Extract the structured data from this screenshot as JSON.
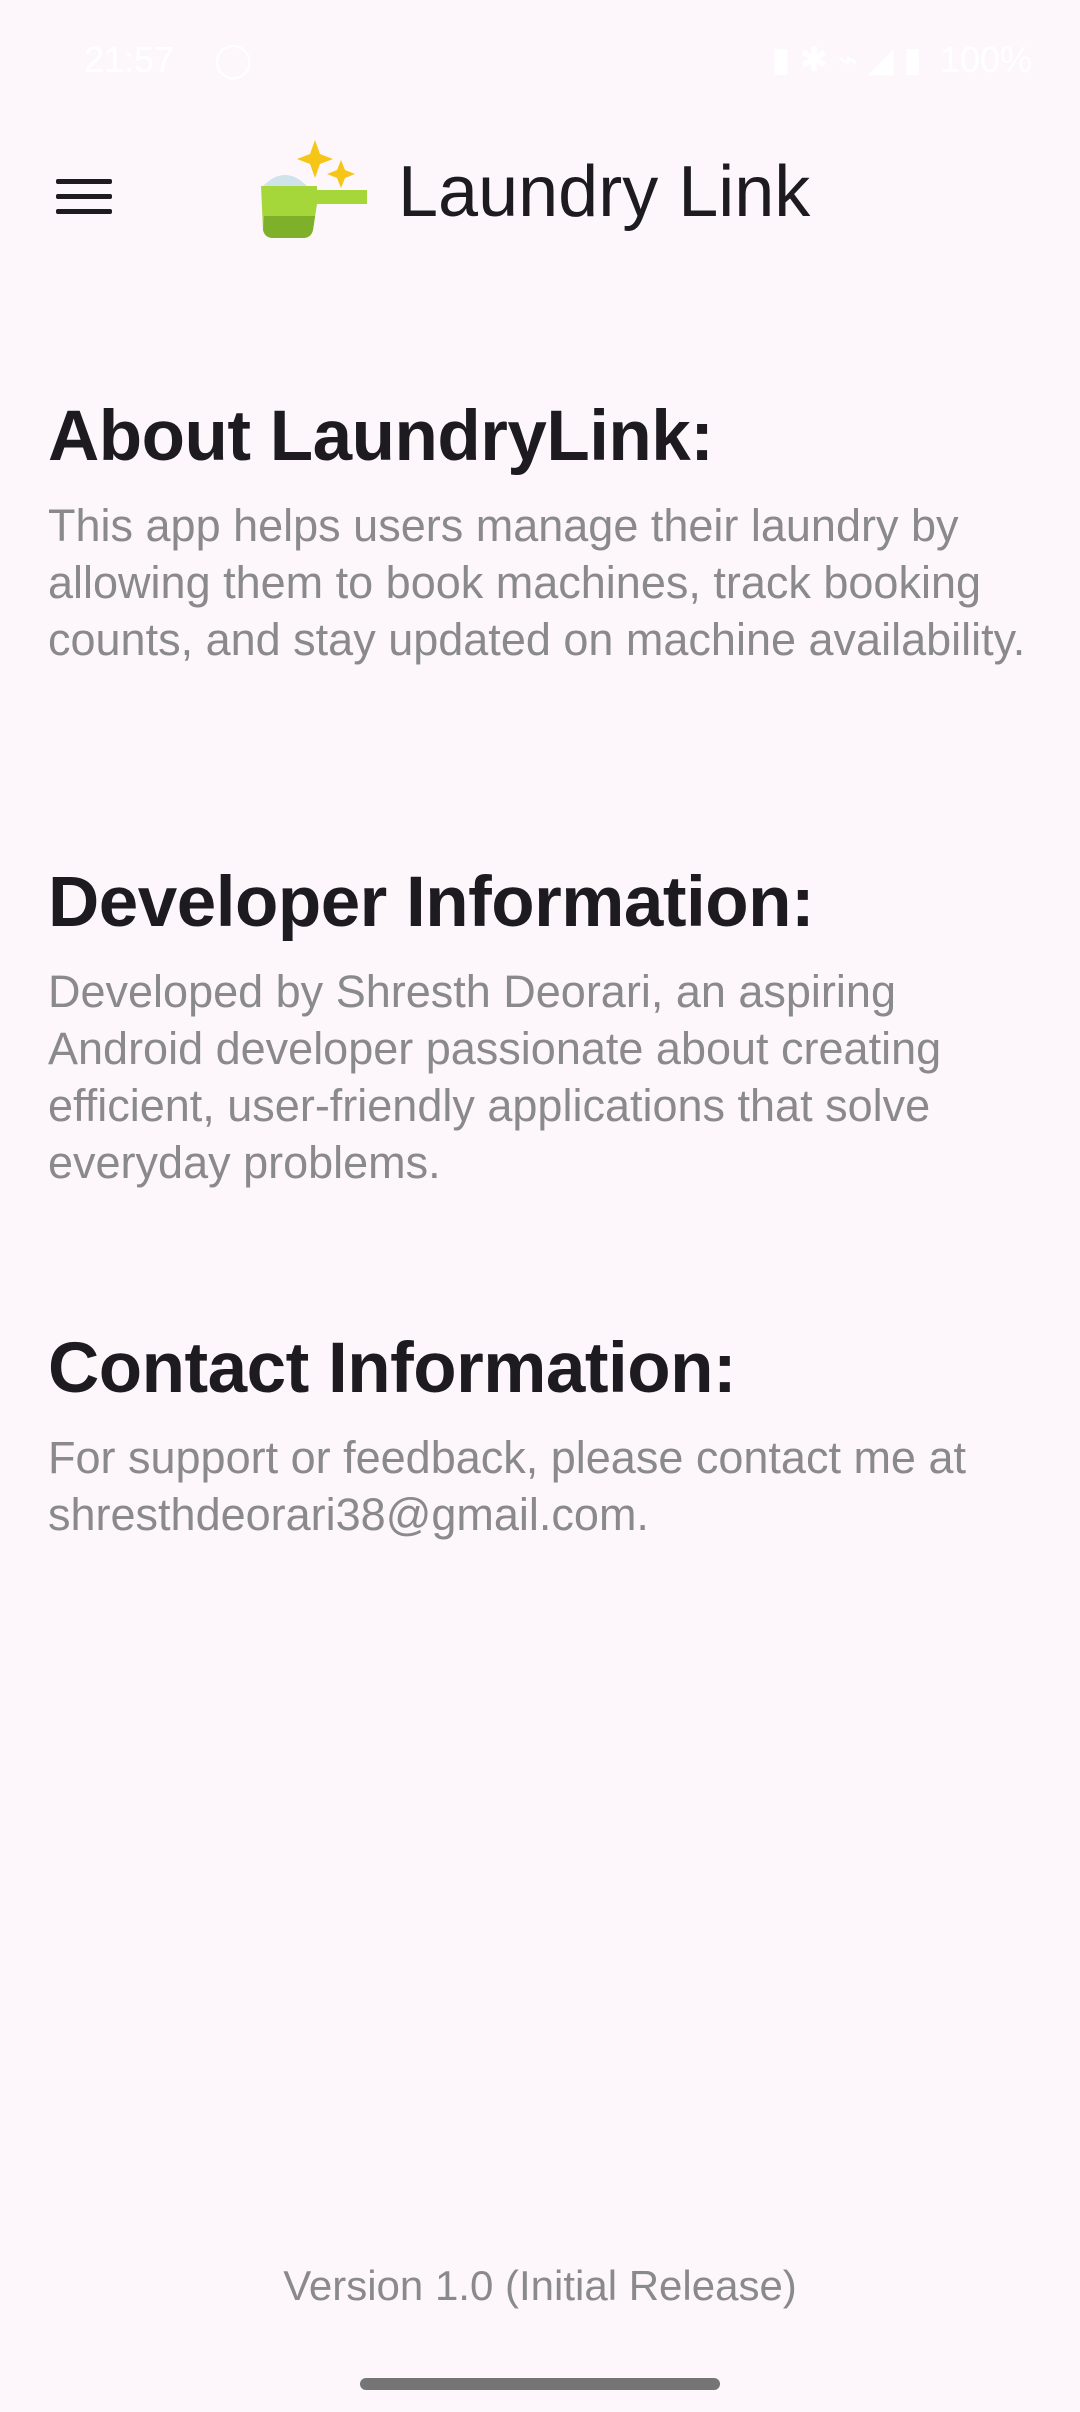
{
  "status_bar": {
    "time": "21:57",
    "whatsapp_icon": "whatsapp-icon",
    "right_glyphs": "▮ ✱ ⌁ ◢ ▮",
    "battery": "100%"
  },
  "app_bar": {
    "menu_icon": "menu-icon",
    "title": "Laundry Link",
    "logo_icon": "laundry-scoop-sparkle-icon"
  },
  "sections": [
    {
      "heading": "About LaundryLink:",
      "body": "This app helps users manage their laundry by allowing them to book machines, track booking counts, and stay updated on machine availability."
    },
    {
      "heading": "Developer Information:",
      "body": "Developed by Shresth Deorari, an aspiring Android developer passionate about creating efficient, user-friendly applications that solve everyday problems."
    },
    {
      "heading": "Contact Information:",
      "body": "For support or feedback, please contact me at shresthdeorari38@gmail.com."
    }
  ],
  "footer": {
    "version": "Version 1.0 (Initial Release)"
  },
  "colors": {
    "background": "#FDF7FC",
    "heading": "#1D1B20",
    "body_text": "#8A8A8A",
    "logo_green": "#9ACD32",
    "sparkle_yellow": "#F5C518"
  }
}
